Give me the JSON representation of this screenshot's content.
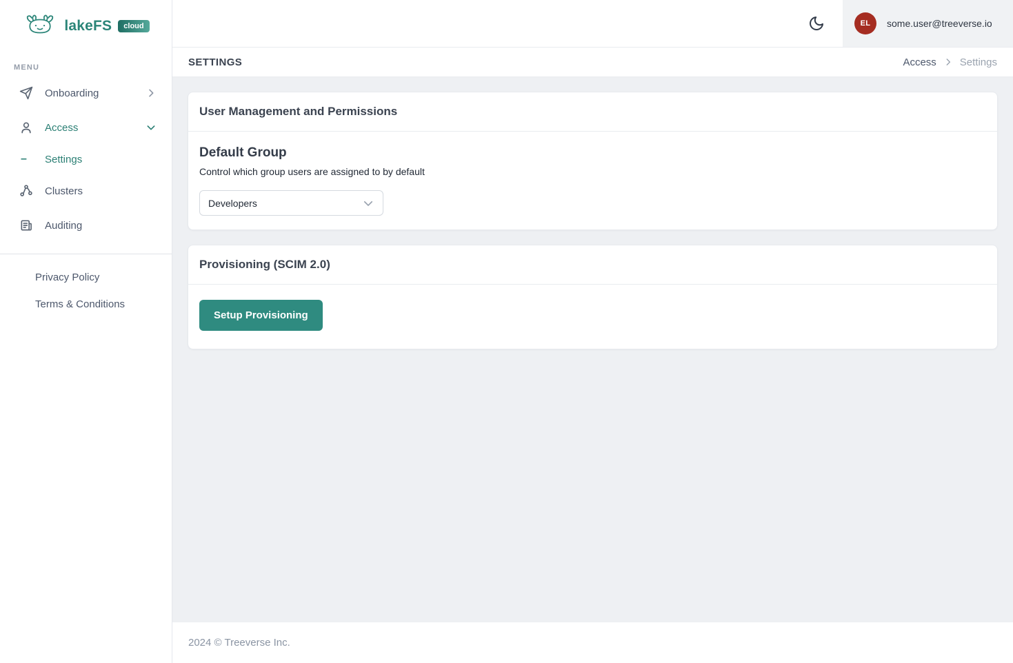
{
  "brand": {
    "name": "lakeFS",
    "badge": "cloud"
  },
  "sidebar": {
    "section_label": "MENU",
    "items": [
      {
        "label": "Onboarding"
      },
      {
        "label": "Access"
      },
      {
        "label": "Settings"
      },
      {
        "label": "Clusters"
      },
      {
        "label": "Auditing"
      }
    ],
    "links": [
      {
        "label": "Privacy Policy"
      },
      {
        "label": "Terms & Conditions"
      }
    ]
  },
  "topbar": {
    "avatar_initials": "EL",
    "user_email": "some.user@treeverse.io"
  },
  "page_header": {
    "title": "SETTINGS",
    "breadcrumb": {
      "parent": "Access",
      "current": "Settings"
    }
  },
  "cards": {
    "user_management": {
      "title": "User Management and Permissions",
      "default_group": {
        "heading": "Default Group",
        "description": "Control which group users are assigned to by default",
        "selected_option": "Developers"
      }
    },
    "provisioning": {
      "title": "Provisioning (SCIM 2.0)",
      "setup_button": "Setup Provisioning"
    }
  },
  "footer": {
    "copyright": "2024 © Treeverse Inc."
  },
  "colors": {
    "accent_teal": "#2f8b80",
    "active_teal": "#2b7f74",
    "avatar_red": "#a52d21"
  }
}
